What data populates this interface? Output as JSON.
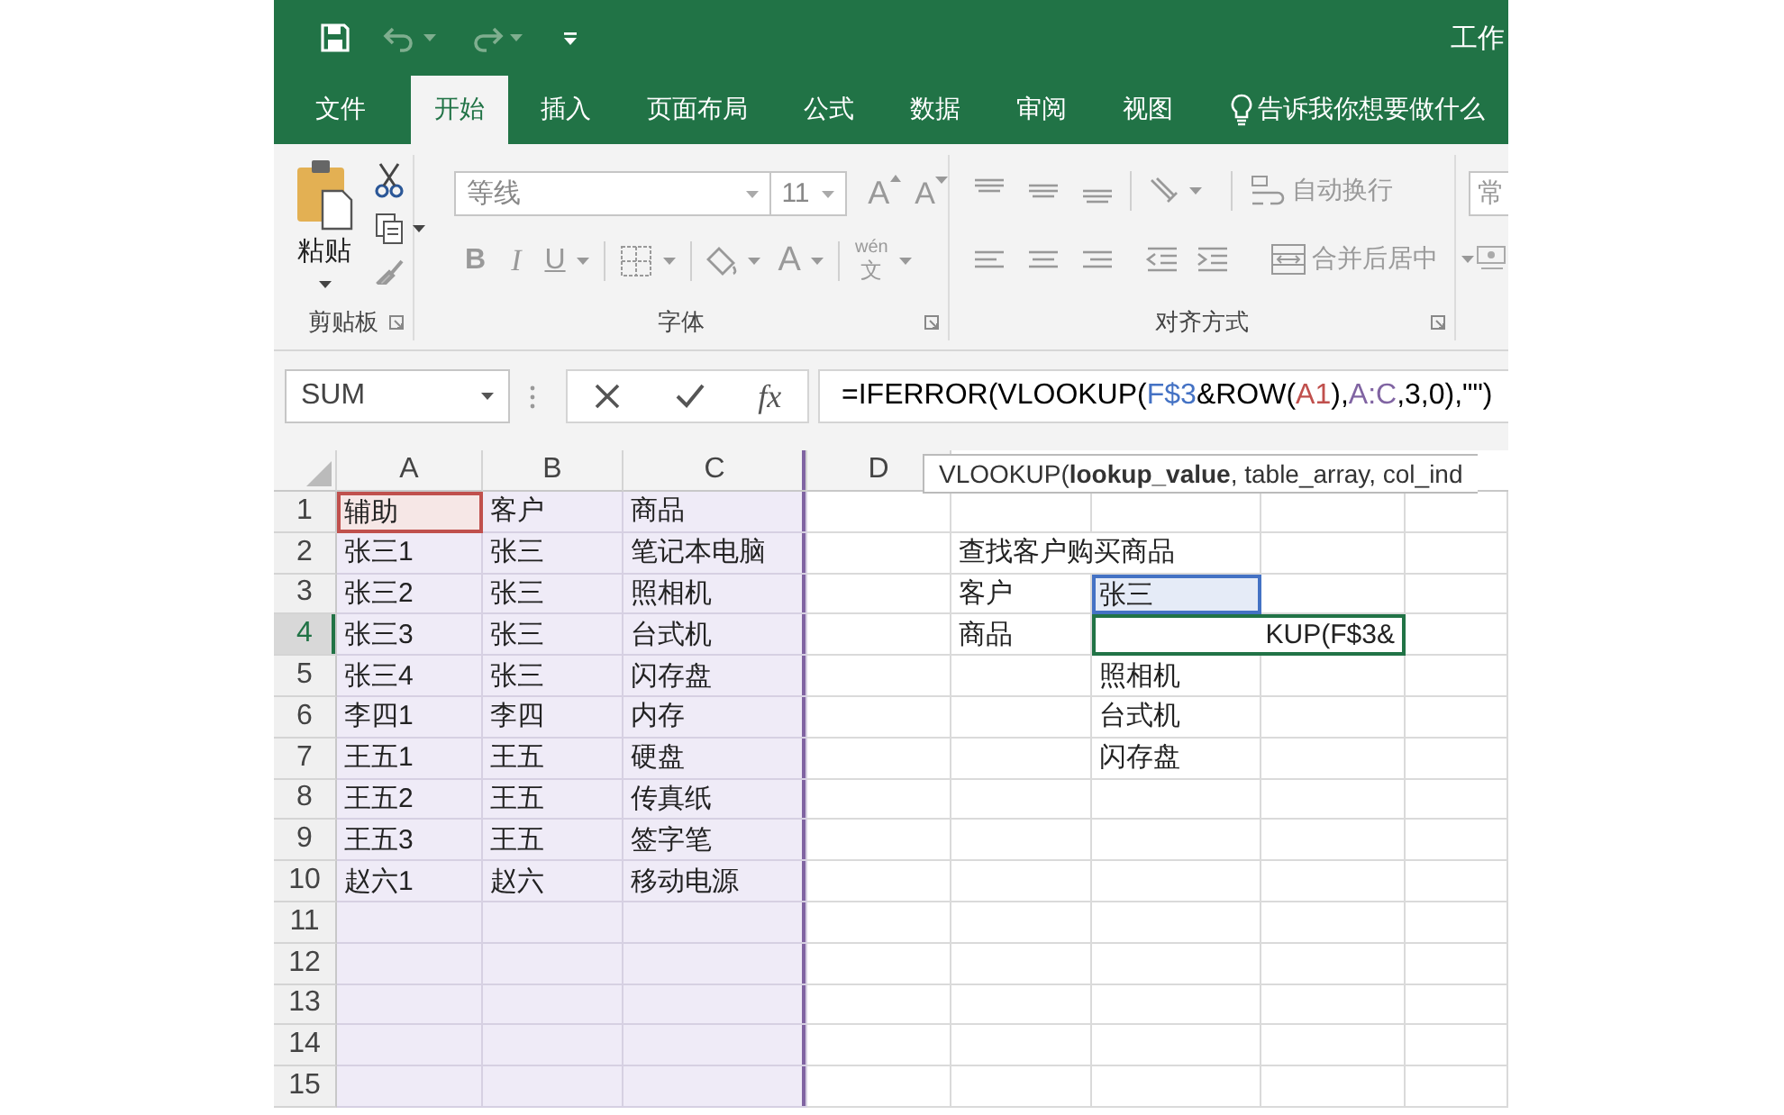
{
  "title_bar": {
    "title": "工作"
  },
  "ribbon_tabs": [
    {
      "label": "文件",
      "selected": false
    },
    {
      "label": "开始",
      "selected": true
    },
    {
      "label": "插入",
      "selected": false
    },
    {
      "label": "页面布局",
      "selected": false
    },
    {
      "label": "公式",
      "selected": false
    },
    {
      "label": "数据",
      "selected": false
    },
    {
      "label": "审阅",
      "selected": false
    },
    {
      "label": "视图",
      "selected": false
    }
  ],
  "tell_me": {
    "label": "告诉我你想要做什么"
  },
  "ribbon": {
    "clipboard": {
      "paste": "粘贴",
      "label": "剪贴板"
    },
    "font": {
      "disabled": true,
      "font_name": "等线",
      "font_size": "11",
      "grow": "A",
      "shrink": "A",
      "bold": "B",
      "italic": "I",
      "underline": "U",
      "font_color": "A",
      "phonetic_top": "wén",
      "phonetic_bottom": "文",
      "label": "字体"
    },
    "alignment": {
      "disabled": true,
      "wrap_text": "自动换行",
      "merge_center": "合并后居中",
      "label": "对齐方式"
    },
    "number": {
      "format": "常"
    }
  },
  "formula_bar": {
    "name_box": "SUM",
    "function_button": "fx",
    "formula": [
      {
        "text": "=IFERROR(VLOOKUP(",
        "color": "#000000"
      },
      {
        "text": "F$3",
        "color": "#4472c4"
      },
      {
        "text": "&ROW(",
        "color": "#000000"
      },
      {
        "text": "A1",
        "color": "#c0504d"
      },
      {
        "text": "),",
        "color": "#000000"
      },
      {
        "text": "A:C",
        "color": "#8064a2"
      },
      {
        "text": ",3,0),\"\")",
        "color": "#000000"
      }
    ]
  },
  "tooltip": {
    "text": "VLOOKUP(**lookup_value**, table_array, col_ind"
  },
  "grid": {
    "columns": [
      {
        "label": "A",
        "in_reference": true
      },
      {
        "label": "B",
        "in_reference": true
      },
      {
        "label": "C",
        "in_reference": true
      },
      {
        "label": "D",
        "in_reference": false
      }
    ],
    "rows": [
      {
        "number": "1",
        "selected": false,
        "cells": [
          {
            "text": "辅助",
            "color": "#c0504d"
          },
          {
            "text": "客户"
          },
          {
            "text": "商品"
          }
        ]
      },
      {
        "number": "2",
        "selected": false,
        "cells": [
          {
            "text": "张三1"
          },
          {
            "text": "张三"
          },
          {
            "text": "笔记本电脑"
          },
          {
            "text": ""
          },
          {
            "text": "查找客户购买商品"
          }
        ]
      },
      {
        "number": "3",
        "selected": false,
        "cells": [
          {
            "text": "张三2"
          },
          {
            "text": "张三"
          },
          {
            "text": "照相机"
          },
          {
            "text": ""
          },
          {
            "text": "客户"
          },
          {
            "text": "张三",
            "color": "#4472c4"
          }
        ]
      },
      {
        "number": "4",
        "selected": true,
        "cells": [
          {
            "text": "张三3"
          },
          {
            "text": "张三"
          },
          {
            "text": "台式机"
          },
          {
            "text": ""
          },
          {
            "text": "商品"
          },
          {
            "text": "KUP(F$3&",
            "editing": true
          }
        ]
      },
      {
        "number": "5",
        "selected": false,
        "cells": [
          {
            "text": "张三4"
          },
          {
            "text": "张三"
          },
          {
            "text": "闪存盘"
          },
          {
            "text": ""
          },
          {
            "text": ""
          },
          {
            "text": "照相机"
          }
        ]
      },
      {
        "number": "6",
        "selected": false,
        "cells": [
          {
            "text": "李四1"
          },
          {
            "text": "李四"
          },
          {
            "text": "内存"
          },
          {
            "text": ""
          },
          {
            "text": ""
          },
          {
            "text": "台式机"
          }
        ]
      },
      {
        "number": "7",
        "selected": false,
        "cells": [
          {
            "text": "王五1"
          },
          {
            "text": "王五"
          },
          {
            "text": "硬盘"
          },
          {
            "text": ""
          },
          {
            "text": ""
          },
          {
            "text": "闪存盘"
          }
        ]
      },
      {
        "number": "8",
        "selected": false,
        "cells": [
          {
            "text": "王五2"
          },
          {
            "text": "王五"
          },
          {
            "text": "传真纸"
          }
        ]
      },
      {
        "number": "9",
        "selected": false,
        "cells": [
          {
            "text": "王五3"
          },
          {
            "text": "王五"
          },
          {
            "text": "签字笔"
          }
        ]
      },
      {
        "number": "10",
        "selected": false,
        "cells": [
          {
            "text": "赵六1"
          },
          {
            "text": "赵六"
          },
          {
            "text": "移动电源"
          }
        ]
      },
      {
        "number": "11",
        "selected": false,
        "cells": []
      },
      {
        "number": "12",
        "selected": false,
        "cells": []
      },
      {
        "number": "13",
        "selected": false,
        "cells": []
      },
      {
        "number": "14",
        "selected": false,
        "cells": []
      },
      {
        "number": "15",
        "selected": false,
        "cells": []
      }
    ]
  }
}
